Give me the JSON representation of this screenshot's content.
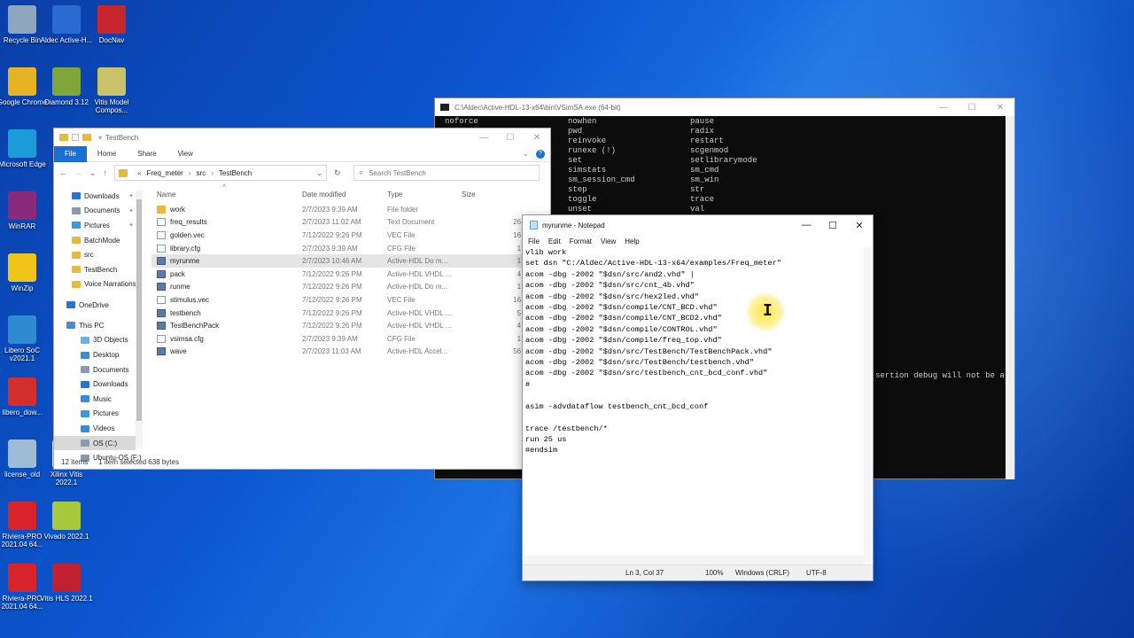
{
  "desktop_icons": [
    {
      "label": "Recycle Bin",
      "color": "#8fa6bf"
    },
    {
      "label": "Aldec Active-H...",
      "color": "#2a6bd1"
    },
    {
      "label": "DocNav",
      "color": "#c8262c"
    },
    {
      "label": "Google Chrome",
      "color": "#e6b325"
    },
    {
      "label": "Diamond 3.12",
      "color": "#7fa63a"
    },
    {
      "label": "Vitis Model Compos...",
      "color": "#c9c26a"
    },
    {
      "label": "Microsoft Edge",
      "color": "#1d9bd8"
    },
    {
      "label": "WinRAR",
      "color": "#8a2a7a"
    },
    {
      "label": "WinZip",
      "color": "#f0c419"
    },
    {
      "label": "Libero SoC v2021.1",
      "color": "#2e8bd1"
    },
    {
      "label": "libero_dow...",
      "color": "#d32f2f"
    },
    {
      "label": "license_old",
      "color": "#9fbcd6"
    },
    {
      "label": "Xilinx Vitis 2022.1",
      "color": "#e6e6e6"
    },
    {
      "label": "Riviera-PRO 2021.04 64...",
      "color": "#d8232a"
    },
    {
      "label": "Vivado 2022.1",
      "color": "#a5c93a"
    },
    {
      "label": "Riviera-PRO 2021.04 64...",
      "color": "#d8232a"
    },
    {
      "label": "Vitis HLS 2022.1",
      "color": "#c02030"
    }
  ],
  "console": {
    "title": "C:\\Aldec\\Active-HDL-13-x64\\bin\\VSimSA.exe (64-bit)",
    "col1": [
      "noforce"
    ],
    "col2": [
      "nowhen",
      "pwd",
      "reinvoke",
      "runexe (!)",
      "set",
      "simstats",
      "sm_session_cmd",
      "step",
      "toggle",
      "unset"
    ],
    "col3": [
      "pause",
      "radix",
      "restart",
      "scgenmod",
      "setlibrarymode",
      "sm_cmd",
      "sm_win",
      "str",
      "trace",
      "val"
    ],
    "extra": "sertion debug will not be a"
  },
  "explorer": {
    "title": "TestBench",
    "ribbon_tabs": [
      "File",
      "Home",
      "Share",
      "View"
    ],
    "breadcrumb": [
      "Freq_meter",
      "src",
      "TestBench"
    ],
    "search_placeholder": "Search TestBench",
    "nav": [
      {
        "label": "Downloads",
        "pin": true,
        "color": "#2a73d6"
      },
      {
        "label": "Documents",
        "pin": true,
        "color": "#8a9bb0"
      },
      {
        "label": "Pictures",
        "pin": true,
        "color": "#3a9bd6"
      },
      {
        "label": "BatchMode",
        "pin": false,
        "color": "#e8b93a"
      },
      {
        "label": "src",
        "pin": false,
        "color": "#e8b93a"
      },
      {
        "label": "TestBench",
        "pin": false,
        "color": "#e8b93a"
      },
      {
        "label": "Voice Narrations",
        "pin": false,
        "color": "#e8b93a"
      },
      {
        "label": "OneDrive",
        "pin": false,
        "color": "#2a73d6"
      },
      {
        "label": "This PC",
        "pin": false,
        "color": "#4a8bd6"
      },
      {
        "label": "3D Objects",
        "pin": false,
        "color": "#6ab0e0"
      },
      {
        "label": "Desktop",
        "pin": false,
        "color": "#3a8bd6"
      },
      {
        "label": "Documents",
        "pin": false,
        "color": "#8a9bb0"
      },
      {
        "label": "Downloads",
        "pin": false,
        "color": "#2a73d6"
      },
      {
        "label": "Music",
        "pin": false,
        "color": "#3a8bd6"
      },
      {
        "label": "Pictures",
        "pin": false,
        "color": "#3a9bd6"
      },
      {
        "label": "Videos",
        "pin": false,
        "color": "#3a8bd6"
      },
      {
        "label": "OS (C:)",
        "pin": false,
        "color": "#8a9bb0"
      },
      {
        "label": "Ubuntu-OS (F:)",
        "pin": false,
        "color": "#8a9bb0"
      }
    ],
    "columns": [
      "Name",
      "Date modified",
      "Type",
      "Size"
    ],
    "files": [
      {
        "name": "work",
        "date": "2/7/2023 9:39 AM",
        "type": "File folder",
        "size": "",
        "icon": "folder"
      },
      {
        "name": "freq_results",
        "date": "2/7/2023 11:02 AM",
        "type": "Text Document",
        "size": "26 KB",
        "icon": "doc"
      },
      {
        "name": "golden.vec",
        "date": "7/12/2022 9:26 PM",
        "type": "VEC File",
        "size": "16 KB",
        "icon": "doc"
      },
      {
        "name": "library.cfg",
        "date": "2/7/2023 9:39 AM",
        "type": "CFG File",
        "size": "1 KB",
        "icon": "doc"
      },
      {
        "name": "myrunme",
        "date": "2/7/2023 10:46 AM",
        "type": "Active-HDL Do m...",
        "size": "1 KB",
        "icon": "ahdl",
        "selected": true
      },
      {
        "name": "pack",
        "date": "7/12/2022 9:26 PM",
        "type": "Active-HDL VHDL ...",
        "size": "4 KB",
        "icon": "ahdl"
      },
      {
        "name": "runme",
        "date": "7/12/2022 9:26 PM",
        "type": "Active-HDL Do m...",
        "size": "1 KB",
        "icon": "ahdl"
      },
      {
        "name": "stimulus.vec",
        "date": "7/12/2022 9:26 PM",
        "type": "VEC File",
        "size": "16 KB",
        "icon": "doc"
      },
      {
        "name": "testbench",
        "date": "7/12/2022 9:26 PM",
        "type": "Active-HDL VHDL ...",
        "size": "5 KB",
        "icon": "ahdl"
      },
      {
        "name": "TestBenchPack",
        "date": "7/12/2022 9:26 PM",
        "type": "Active-HDL VHDL ...",
        "size": "4 KB",
        "icon": "ahdl"
      },
      {
        "name": "vsimsa.cfg",
        "date": "2/7/2023 9:39 AM",
        "type": "CFG File",
        "size": "1 KB",
        "icon": "doc"
      },
      {
        "name": "wave",
        "date": "2/7/2023 11:03 AM",
        "type": "Active-HDL Accel...",
        "size": "56 KB",
        "icon": "ahdl"
      }
    ],
    "status_count": "12 items",
    "status_selected": "1 item selected  638 bytes"
  },
  "notepad": {
    "title": "myrunme - Notepad",
    "menu": [
      "File",
      "Edit",
      "Format",
      "View",
      "Help"
    ],
    "text": "vlib work\nset dsn \"C:/Aldec/Active-HDL-13-x64/examples/Freq_meter\"\nacom -dbg -2002 \"$dsn/src/and2.vhd\" |\nacom -dbg -2002 \"$dsn/src/cnt_4b.vhd\"\nacom -dbg -2002 \"$dsn/src/hex2led.vhd\"\nacom -dbg -2002 \"$dsn/compile/CNT_BCD.vhd\"\nacom -dbg -2002 \"$dsn/compile/CNT_BCD2.vhd\"\nacom -dbg -2002 \"$dsn/compile/CONTROL.vhd\"\nacom -dbg -2002 \"$dsn/compile/freq_top.vhd\"\nacom -dbg -2002 \"$dsn/src/TestBench/TestBenchPack.vhd\"\nacom -dbg -2002 \"$dsn/src/TestBench/testbench.vhd\"\nacom -dbg -2002 \"$dsn/src/testbench_cnt_bcd_conf.vhd\"\n#\n\nasim -advdataflow testbench_cnt_bcd_conf\n\ntrace /testbench/*\nrun 25 us\n#endsim",
    "status_pos": "Ln 3, Col 37",
    "status_zoom": "100%",
    "status_eol": "Windows (CRLF)",
    "status_enc": "UTF-8"
  }
}
